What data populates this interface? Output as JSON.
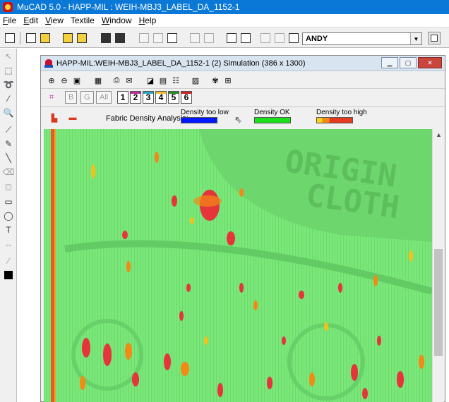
{
  "app": {
    "title": "MuCAD 5.0  -  HAPP-MIL : WEIH-MBJ3_LABEL_DA_1152-1"
  },
  "menu": {
    "items": [
      {
        "underline": "F",
        "rest": "ile"
      },
      {
        "underline": "E",
        "rest": "dit"
      },
      {
        "underline": "V",
        "rest": "iew"
      },
      {
        "underline": "",
        "rest": "Textile"
      },
      {
        "underline": "W",
        "rest": "indow"
      },
      {
        "underline": "H",
        "rest": "elp"
      }
    ]
  },
  "toolbar": {
    "user_value": "ANDY"
  },
  "document": {
    "title": "HAPP-MIL:WEIH-MBJ3_LABEL_DA_1152-1 (2) Simulation (386 x 1300)"
  },
  "colorways": {
    "labels": [
      "B",
      "G",
      "All"
    ],
    "numbers": [
      "1",
      "2",
      "3",
      "4",
      "5",
      "6"
    ],
    "number_colors": [
      "#ffffff",
      "#c0309a",
      "#27a9c9",
      "#f1c232",
      "#2c8a2c",
      "#d02020"
    ]
  },
  "density": {
    "label": "Fabric Density Analysis:",
    "low": "Density too low",
    "ok": "Density OK",
    "high": "Density too high",
    "low_color": "#0018ff",
    "ok_color": "#19e019",
    "high_colors": [
      "#f6d21b",
      "#f28a16",
      "#e43a1e"
    ]
  },
  "canvas": {
    "watermark_line1": "ORIGIN",
    "watermark_line2": "CLOTH",
    "base_color": "#79e879"
  }
}
